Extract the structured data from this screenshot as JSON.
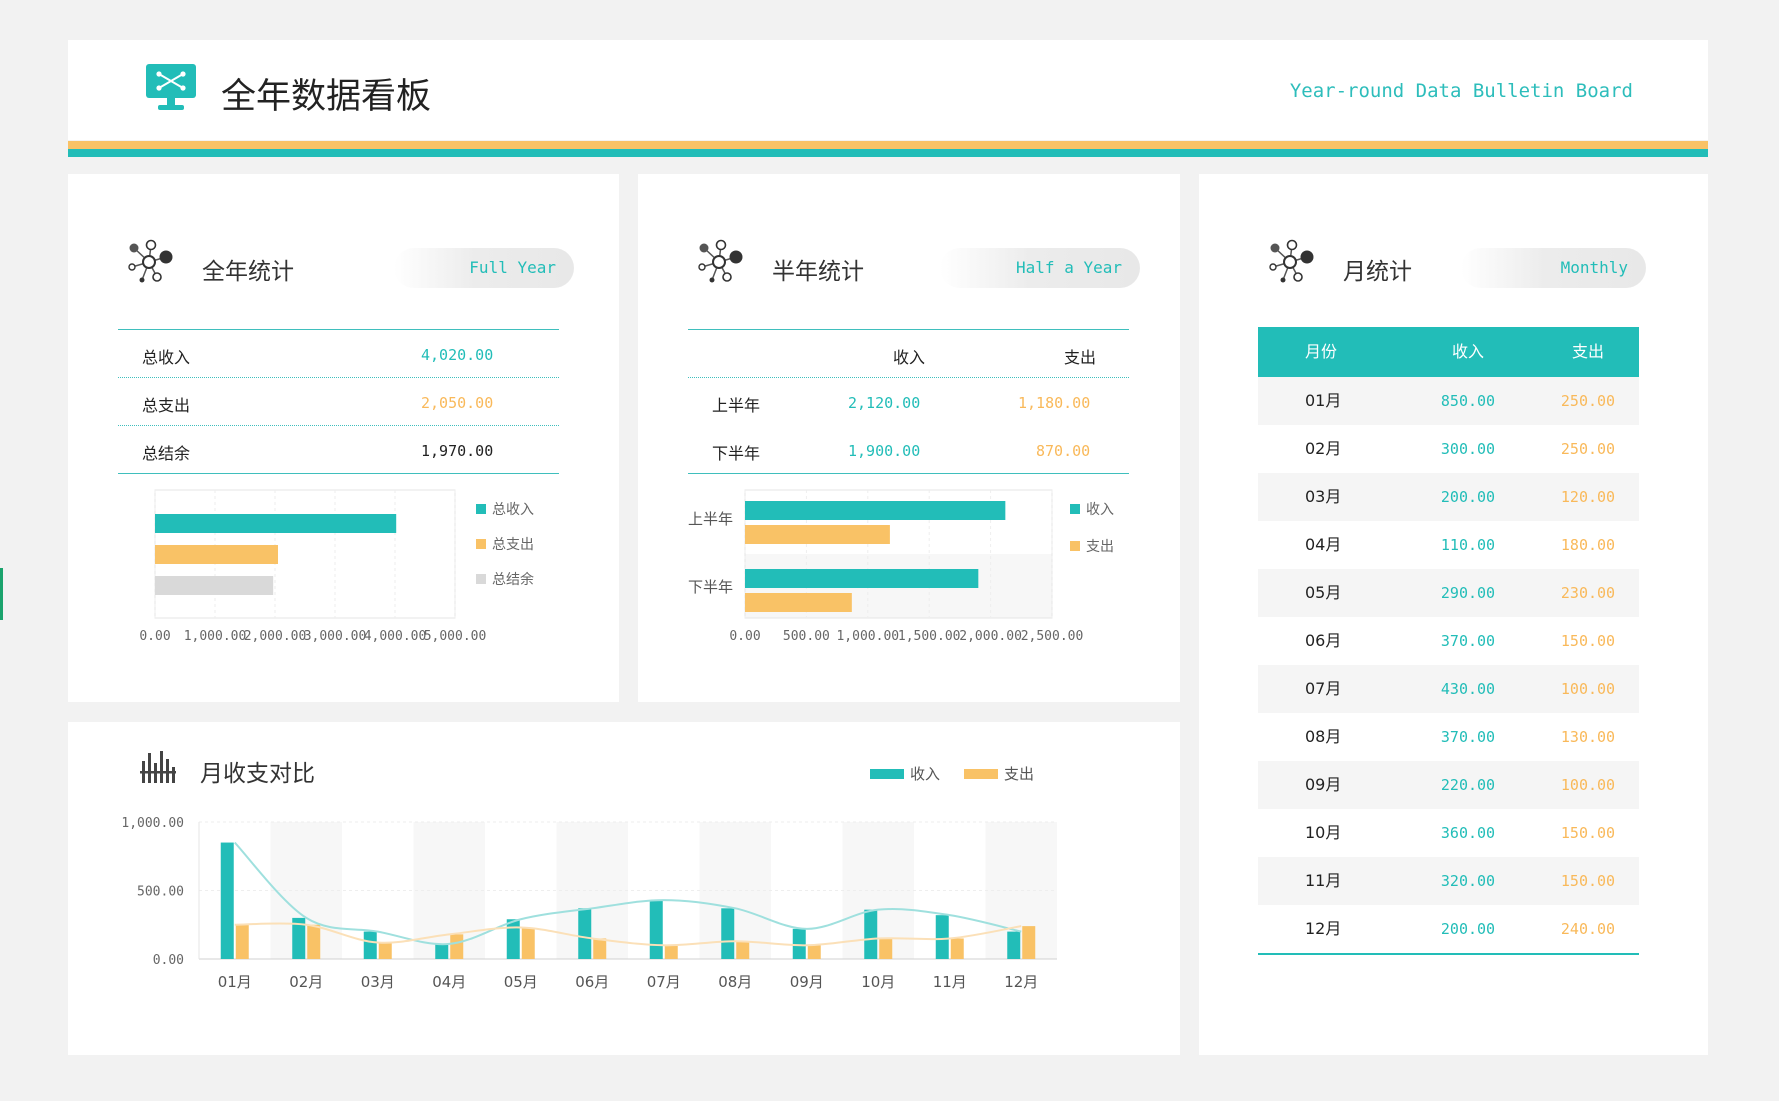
{
  "header": {
    "title": "全年数据看板",
    "subtitle": "Year-round Data Bulletin Board",
    "icon": "monitor-icon"
  },
  "colors": {
    "teal": "#22bdb8",
    "orange": "#f9c266",
    "gray": "#d9d9d9"
  },
  "full_year": {
    "title": "全年统计",
    "pill": "Full Year",
    "rows": [
      {
        "label": "总收入",
        "value": "4,020.00"
      },
      {
        "label": "总支出",
        "value": "2,050.00"
      },
      {
        "label": "总结余",
        "value": "1,970.00"
      }
    ]
  },
  "half_year": {
    "title": "半年统计",
    "pill": "Half a Year",
    "col_income": "收入",
    "col_expense": "支出",
    "rows": [
      {
        "label": "上半年",
        "income": "2,120.00",
        "expense": "1,180.00"
      },
      {
        "label": "下半年",
        "income": "1,900.00",
        "expense": "870.00"
      }
    ]
  },
  "monthly": {
    "title": "月统计",
    "pill": "Monthly",
    "headers": {
      "month": "月份",
      "income": "收入",
      "expense": "支出"
    },
    "rows": [
      {
        "month": "01月",
        "income": "850.00",
        "expense": "250.00"
      },
      {
        "month": "02月",
        "income": "300.00",
        "expense": "250.00"
      },
      {
        "month": "03月",
        "income": "200.00",
        "expense": "120.00"
      },
      {
        "month": "04月",
        "income": "110.00",
        "expense": "180.00"
      },
      {
        "month": "05月",
        "income": "290.00",
        "expense": "230.00"
      },
      {
        "month": "06月",
        "income": "370.00",
        "expense": "150.00"
      },
      {
        "month": "07月",
        "income": "430.00",
        "expense": "100.00"
      },
      {
        "month": "08月",
        "income": "370.00",
        "expense": "130.00"
      },
      {
        "month": "09月",
        "income": "220.00",
        "expense": "100.00"
      },
      {
        "month": "10月",
        "income": "360.00",
        "expense": "150.00"
      },
      {
        "month": "11月",
        "income": "320.00",
        "expense": "150.00"
      },
      {
        "month": "12月",
        "income": "200.00",
        "expense": "240.00"
      }
    ]
  },
  "compare": {
    "title": "月收支对比"
  },
  "chart_data": [
    {
      "type": "bar",
      "orientation": "horizontal",
      "categories": [
        "总收入",
        "总支出",
        "总结余"
      ],
      "values": [
        4020,
        2050,
        1970
      ],
      "colors": [
        "#22bdb8",
        "#f9c266",
        "#d9d9d9"
      ],
      "xlim": [
        0,
        5000
      ],
      "xticks": [
        "0.00",
        "1,000.00",
        "2,000.00",
        "3,000.00",
        "4,000.00",
        "5,000.00"
      ],
      "legend": [
        "总收入",
        "总支出",
        "总结余"
      ],
      "legend_position": "right"
    },
    {
      "type": "bar",
      "orientation": "horizontal",
      "categories": [
        "上半年",
        "下半年"
      ],
      "series": [
        {
          "name": "收入",
          "values": [
            2120,
            1900
          ],
          "color": "#22bdb8"
        },
        {
          "name": "支出",
          "values": [
            1180,
            870
          ],
          "color": "#f9c266"
        }
      ],
      "xlim": [
        0,
        2500
      ],
      "xticks": [
        "0.00",
        "500.00",
        "1,000.00",
        "1,500.00",
        "2,000.00",
        "2,500.00"
      ],
      "legend_position": "right"
    },
    {
      "type": "bar",
      "categories": [
        "01月",
        "02月",
        "03月",
        "04月",
        "05月",
        "06月",
        "07月",
        "08月",
        "09月",
        "10月",
        "11月",
        "12月"
      ],
      "series": [
        {
          "name": "收入",
          "values": [
            850,
            300,
            200,
            110,
            290,
            370,
            430,
            370,
            220,
            360,
            320,
            200
          ],
          "color": "#22bdb8"
        },
        {
          "name": "支出",
          "values": [
            250,
            250,
            120,
            180,
            230,
            150,
            100,
            130,
            100,
            150,
            150,
            240
          ],
          "color": "#f9c266"
        }
      ],
      "ylim": [
        0,
        1000
      ],
      "yticks": [
        "0.00",
        "500.00",
        "1,000.00"
      ],
      "smoothed_lines": true,
      "legend_position": "top-right"
    }
  ]
}
